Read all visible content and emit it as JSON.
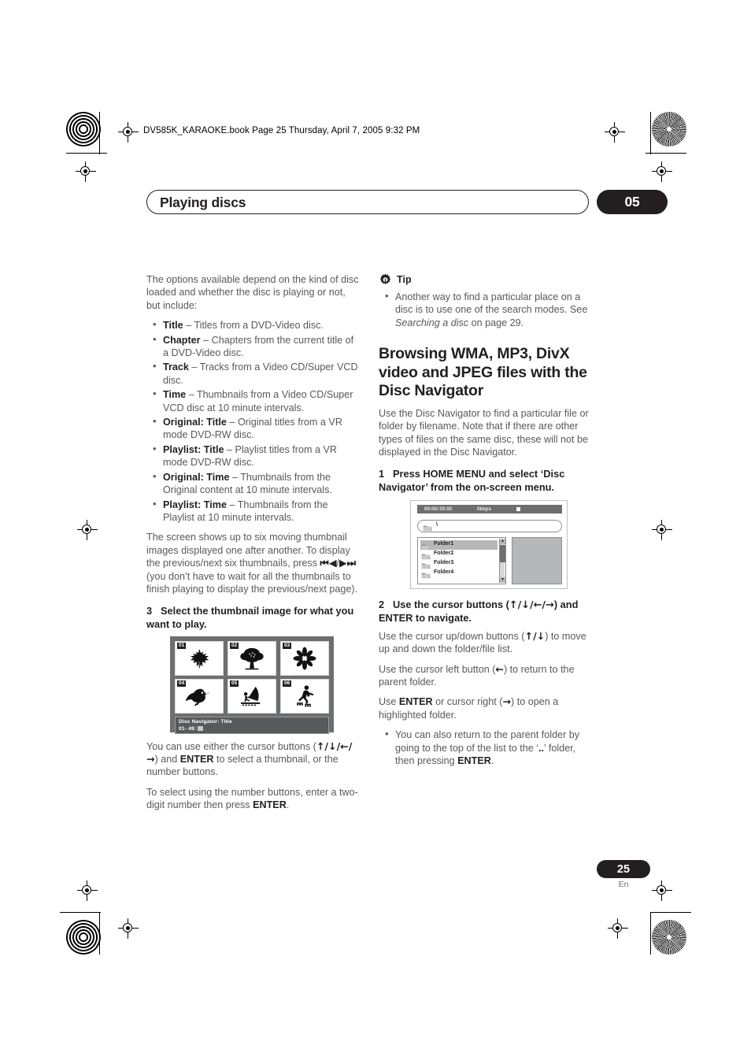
{
  "book_header": "DV585K_KARAOKE.book  Page 25  Thursday, April 7, 2005  9:32 PM",
  "chapter": {
    "title": "Playing discs",
    "number": "05"
  },
  "page_footer": {
    "page_number": "25",
    "language": "En"
  },
  "left_column": {
    "intro": "The options available depend on the kind of disc loaded and whether the disc is playing or not, but include:",
    "options": [
      {
        "term": "Title",
        "desc": " – Titles from a DVD-Video disc."
      },
      {
        "term": "Chapter",
        "desc": " – Chapters from the current title of a DVD-Video disc."
      },
      {
        "term": "Track",
        "desc": " – Tracks from a Video CD/Super VCD disc."
      },
      {
        "term": "Time",
        "desc": " – Thumbnails from a Video CD/Super VCD disc at 10 minute intervals."
      },
      {
        "term": "Original: Title",
        "desc": " – Original titles from a VR mode DVD-RW disc."
      },
      {
        "term": "Playlist: Title",
        "desc": " – Playlist titles from a VR mode DVD-RW disc."
      },
      {
        "term": "Original: Time",
        "desc": " – Thumbnails from the Original content at 10 minute intervals."
      },
      {
        "term": "Playlist: Time",
        "desc": " – Thumbnails from the Playlist at 10 minute intervals."
      }
    ],
    "screen_para_1": "The screen shows up to six moving thumbnail images displayed one after another. To display the previous/next six thumbnails, press ",
    "screen_para_prev_icon": "⏮◀",
    "screen_para_sep": "/",
    "screen_para_next_icon": "▶⏭",
    "screen_para_2": " (you don’t have to wait for all the thumbnails to finish playing to display the previous/next page).",
    "step3": {
      "num": "3",
      "text": "Select the thumbnail image for what you want to play."
    },
    "thumbnail_figure": {
      "thumbs": [
        {
          "number": "01",
          "icon": "maple-leaf-icon"
        },
        {
          "number": "02",
          "icon": "tree-icon"
        },
        {
          "number": "03",
          "icon": "flower-icon"
        },
        {
          "number": "04",
          "icon": "toucan-icon"
        },
        {
          "number": "05",
          "icon": "windsurfer-icon"
        },
        {
          "number": "06",
          "icon": "rollerblader-icon"
        }
      ],
      "caption_line1": "Disc Navigator: Title",
      "caption_line2": "01- 49:"
    },
    "cursor_para_a": "You can use either the cursor buttons (",
    "cursor_glyphs_ud": "↑/↓/",
    "cursor_glyphs_lr": "←/→",
    "cursor_para_b": ") and ",
    "cursor_enter": "ENTER",
    "cursor_para_c": " to select a thumbnail, or the number buttons.",
    "number_para_a": "To select using the number buttons, enter a two-digit number then press ",
    "number_enter": "ENTER",
    "number_para_b": "."
  },
  "right_column": {
    "tip": {
      "icon": "gear-icon",
      "label": "Tip",
      "bullet_a": "Another way to find a particular place on a disc is to use one of the search modes. See ",
      "bullet_italic": "Searching a disc",
      "bullet_b": " on page 29."
    },
    "section_heading": "Browsing WMA, MP3, DivX video and JPEG files with the Disc Navigator",
    "section_intro": "Use the Disc Navigator to find a particular file or folder by filename. Note that if there are other types of files on the same disc, these will not be displayed in the Disc Navigator.",
    "step1": {
      "num": "1",
      "text": "Press HOME MENU and select ‘Disc Navigator’ from the on-screen menu."
    },
    "nav_figure": {
      "time": "00:00/ 00:00",
      "bitrate": "0kbps",
      "path": "\\",
      "folders": [
        {
          "label": "Folder1",
          "selected": true
        },
        {
          "label": "Folder2",
          "selected": false
        },
        {
          "label": "Folder3",
          "selected": false
        },
        {
          "label": "Folder4",
          "selected": false
        }
      ]
    },
    "step2": {
      "num": "2",
      "text_a": "Use the cursor buttons (",
      "glyphs": "↑/↓/←/→",
      "text_b": ") and ENTER to navigate."
    },
    "para_updown_a": "Use the cursor up/down buttons (",
    "para_updown_glyphs": "↑/↓",
    "para_updown_b": ") to move up and down the folder/file list.",
    "para_left_a": "Use the cursor left button (",
    "para_left_glyph": "←",
    "para_left_b": ") to return to the parent folder.",
    "para_enter_a": "Use ",
    "para_enter_bold": "ENTER",
    "para_enter_b": " or cursor right (",
    "para_enter_glyph": "→",
    "para_enter_c": ") to open a highlighted folder.",
    "bullet_parent_a": "You can also return to the parent folder by going to the top of the list to the ‘",
    "bullet_parent_dots": "..",
    "bullet_parent_b": "’ folder, then pressing ",
    "bullet_parent_enter": "ENTER",
    "bullet_parent_c": "."
  }
}
